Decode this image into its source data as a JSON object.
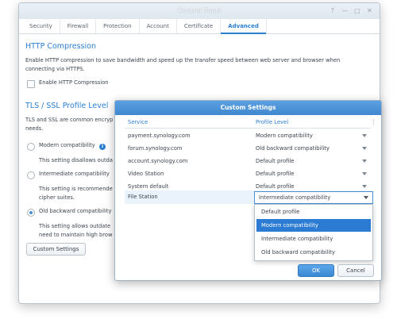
{
  "window": {
    "title": "Control Panel",
    "controls": [
      "?",
      "—",
      "□",
      "✕"
    ]
  },
  "tabs": [
    {
      "label": "Security"
    },
    {
      "label": "Firewall"
    },
    {
      "label": "Protection"
    },
    {
      "label": "Account"
    },
    {
      "label": "Certificate"
    },
    {
      "label": "Advanced",
      "active": true
    }
  ],
  "http": {
    "title": "HTTP Compression",
    "description_line1": "Enable HTTP compression to save bandwidth and speed up the transfer speed between web server and browser when",
    "description_line2": "connecting via HTTPS.",
    "checkbox_label": "Enable HTTP Compression",
    "checked": false
  },
  "tls": {
    "title": "TLS / SSL Profile Level",
    "intro_line1": "TLS and SSL are common encryp",
    "intro_line2": "needs.",
    "options": [
      {
        "label": "Modern compatibility",
        "desc_line1": "This setting disallows outda",
        "desc_line2": "",
        "selected": false
      },
      {
        "label": "Intermediate compatibility",
        "desc_line1": "This setting is recommende",
        "desc_line2": "cipher suites.",
        "selected": false
      },
      {
        "label": "Old backward compatibility",
        "desc_line1": "This setting allows outdate",
        "desc_line2": "need to maintain high brow",
        "selected": true
      }
    ],
    "custom_button": "Custom Settings"
  },
  "dialog": {
    "title": "Custom Settings",
    "col_service": "Service",
    "col_profile": "Profile Level",
    "col_menu": "⋮",
    "rows": [
      {
        "service": "payment.synology.com",
        "profile": "Modern compatibility"
      },
      {
        "service": "forum.synology.com",
        "profile": "Old backward compatibility"
      },
      {
        "service": "account.synology.com",
        "profile": "Default profile"
      },
      {
        "service": "Video Station",
        "profile": "Default profile"
      },
      {
        "service": "System default",
        "profile": "Default profile"
      }
    ],
    "editing_row": {
      "service": "File Station",
      "profile": "Intermediate compatibility"
    },
    "dropdown_options": [
      "Default profile",
      "Modern compatibility",
      "Intermediate compatibility",
      "Old backward compatibility"
    ],
    "highlighted_option": "Modern compatibility",
    "ok_label": "OK",
    "cancel_label": "Cancel"
  },
  "colors": {
    "accent": "#2b7fd0",
    "selected_row": "#eaf2fb",
    "highlight": "#2a7bd1"
  }
}
